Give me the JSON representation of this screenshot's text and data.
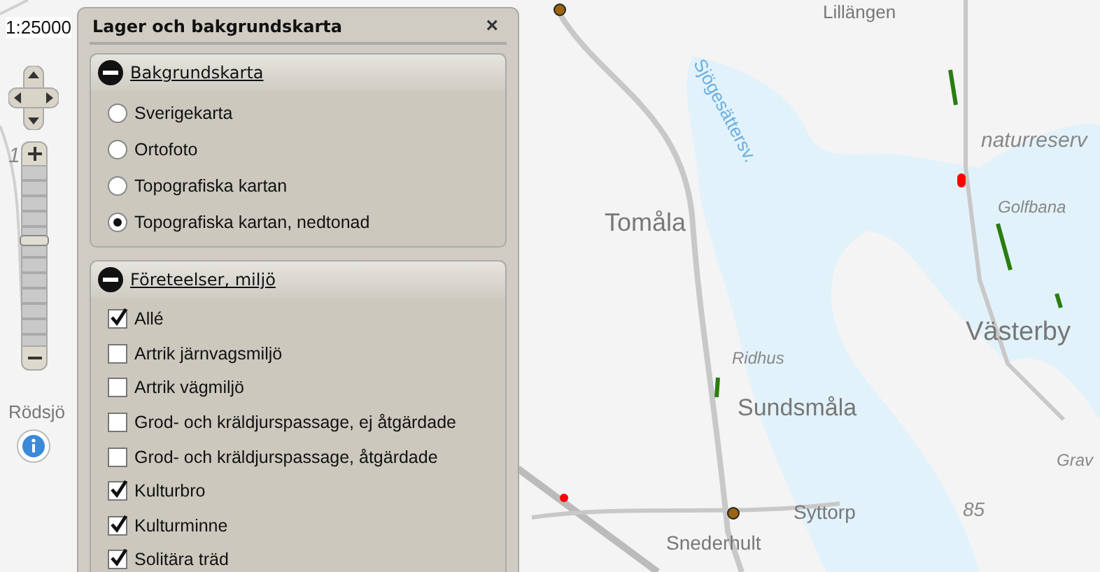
{
  "map": {
    "scale": "1:25000",
    "labels": [
      {
        "text": "Lillängen",
        "kind": "place"
      },
      {
        "text": "Sjögesättersv.",
        "kind": "water"
      },
      {
        "text": "naturreserv",
        "kind": "area"
      },
      {
        "text": "Tomåla",
        "kind": "town"
      },
      {
        "text": "Golfbana",
        "kind": "area"
      },
      {
        "text": "Västerby",
        "kind": "town"
      },
      {
        "text": "Ridhus",
        "kind": "area"
      },
      {
        "text": "Sundsmåla",
        "kind": "town"
      },
      {
        "text": "Grav",
        "kind": "area"
      },
      {
        "text": "85",
        "kind": "area"
      },
      {
        "text": "Syttorp",
        "kind": "place"
      },
      {
        "text": "Snederhult",
        "kind": "place"
      },
      {
        "text": "Rödsjö",
        "kind": "place"
      },
      {
        "text": "1",
        "kind": "area"
      }
    ],
    "zoom": {
      "level": 0.6
    }
  },
  "panel": {
    "title": "Lager och bakgrundskarta",
    "close": "×",
    "sections": [
      {
        "title": "Bakgrundskarta",
        "expanded": true,
        "kind": "radio",
        "items": [
          {
            "label": "Sverigekarta",
            "selected": false
          },
          {
            "label": "Ortofoto",
            "selected": false
          },
          {
            "label": "Topografiska kartan",
            "selected": false
          },
          {
            "label": "Topografiska kartan, nedtonad",
            "selected": true
          }
        ]
      },
      {
        "title": "Företeelser, miljö",
        "expanded": true,
        "kind": "checkbox",
        "items": [
          {
            "label": "Allé",
            "checked": true
          },
          {
            "label": "Artrik järnvagsmiljö",
            "checked": false
          },
          {
            "label": "Artrik vägmiljö",
            "checked": false
          },
          {
            "label": "Grod- och kräldjurspassage, ej åtgärdade",
            "checked": false
          },
          {
            "label": "Grod- och kräldjurspassage, åtgärdade",
            "checked": false
          },
          {
            "label": "Kulturbro",
            "checked": true
          },
          {
            "label": "Kulturminne",
            "checked": true
          },
          {
            "label": "Solitära träd",
            "checked": true
          }
        ]
      }
    ]
  }
}
